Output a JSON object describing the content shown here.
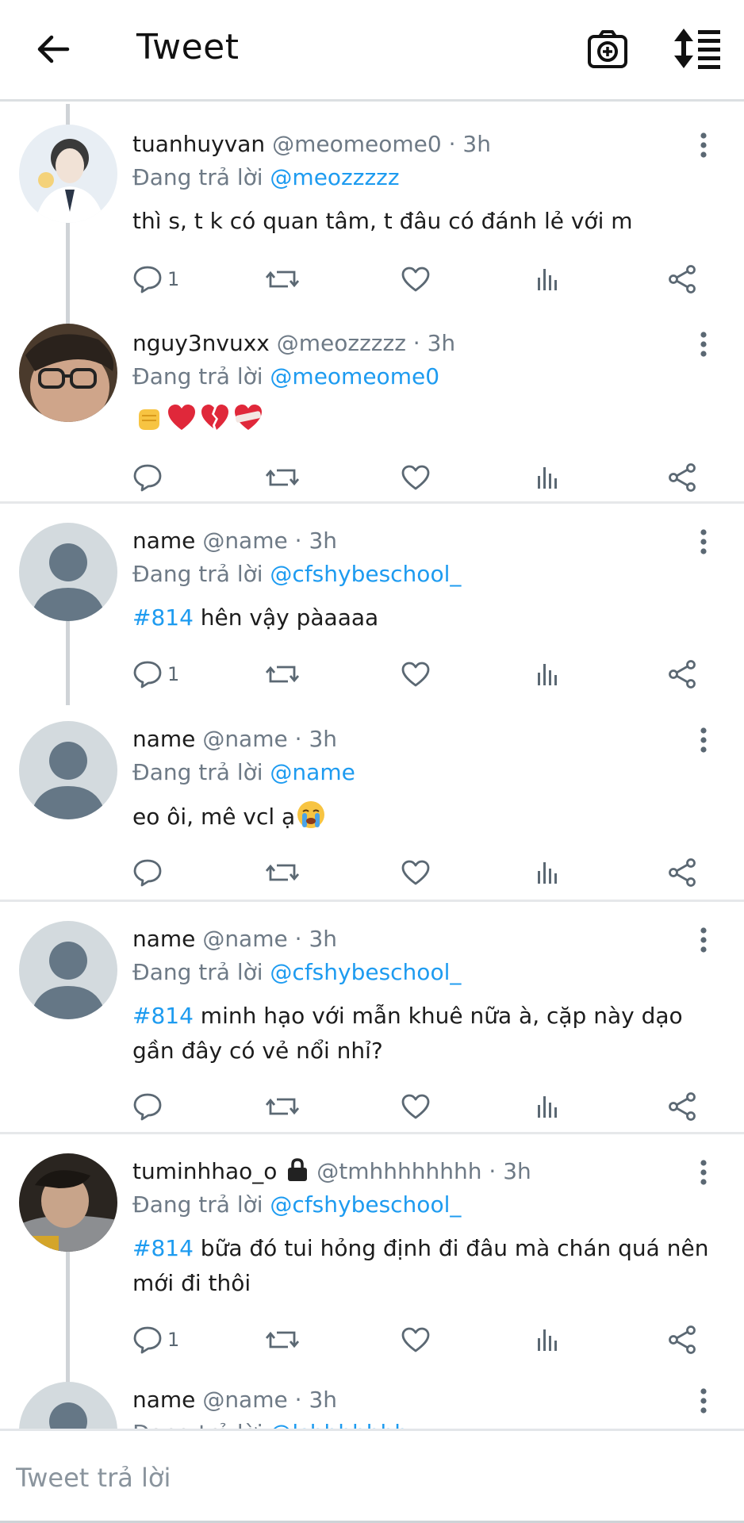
{
  "header": {
    "title": "Tweet",
    "back_icon": "arrow-left-icon",
    "camera_icon": "camera-add-icon",
    "sort_icon": "sort-list-icon"
  },
  "colors": {
    "accent": "#1d9bf0",
    "muted": "#6e7a86",
    "avatar_placeholder_bg": "#d3dade",
    "avatar_placeholder_fg": "#657786"
  },
  "tweets": [
    {
      "display_name": "tuanhuyvan",
      "handle": "@meomeome0",
      "time": "3h",
      "replying_prefix": "Đang trả lời",
      "replying_to": "@meozzzzz",
      "hashtag": "",
      "text": "thì s, t k có quan tâm, t đâu có đánh lẻ với m",
      "reply_count": "1"
    },
    {
      "display_name": "nguy3nvuxx",
      "handle": "@meozzzzz",
      "time": "3h",
      "replying_prefix": "Đang trả lời",
      "replying_to": "@meomeome0",
      "emoji": [
        "fist-emoji",
        "red-heart-emoji",
        "broken-heart-emoji",
        "mending-heart-emoji"
      ],
      "reply_count": ""
    },
    {
      "display_name": "name",
      "handle": "@name",
      "time": "3h",
      "replying_prefix": "Đang trả lời",
      "replying_to": "@cfshybeschool_",
      "hashtag": "#814",
      "text": " hên vậy pàaaaa",
      "reply_count": "1"
    },
    {
      "display_name": "name",
      "handle": "@name",
      "time": "3h",
      "replying_prefix": "Đang trả lời",
      "replying_to": "@name",
      "hashtag": "",
      "text": "eo ôi, mê vcl ạ",
      "emoji": [
        "crying-face-emoji"
      ],
      "reply_count": ""
    },
    {
      "display_name": "name",
      "handle": "@name",
      "time": "3h",
      "replying_prefix": "Đang trả lời",
      "replying_to": "@cfshybeschool_",
      "hashtag": "#814",
      "text": " minh hạo với mẫn khuê nữa à, cặp này dạo gần đây có vẻ nổi nhỉ?",
      "reply_count": ""
    },
    {
      "display_name": "tuminhhao_o",
      "handle": "@tmhhhhhhhh",
      "time": "3h",
      "replying_prefix": "Đang trả lời",
      "replying_to": "@cfshybeschool_",
      "hashtag": "#814",
      "text": " bữa đó tui hỏng định đi đâu mà chán quá nên mới đi thôi",
      "reply_count": "1",
      "lock_icon": "lock-icon"
    },
    {
      "display_name": "name",
      "handle": "@name",
      "time": "3h",
      "replying_prefix": "Đang trả lời",
      "replying_to": "@lshhhhhhh",
      "hashtag": "",
      "text": "",
      "reply_count": ""
    }
  ],
  "reply_bar": {
    "placeholder": "Tweet trả lời"
  }
}
